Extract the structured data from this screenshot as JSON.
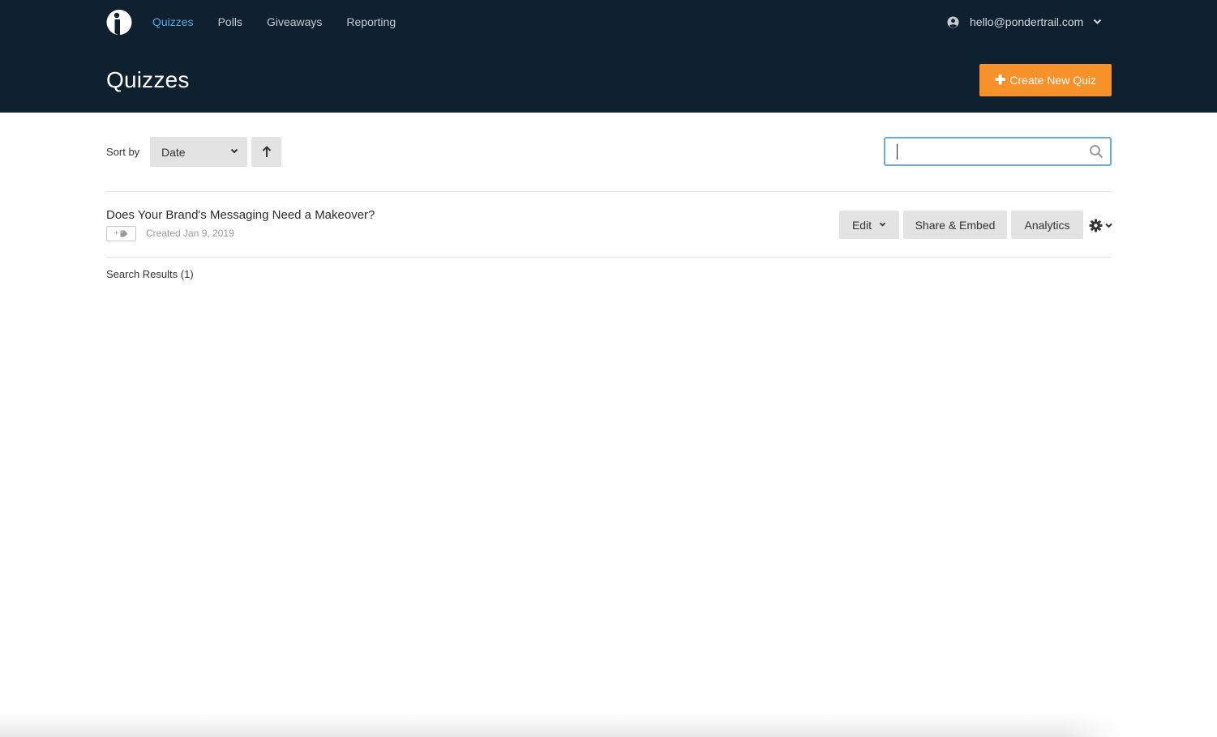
{
  "nav": {
    "items": [
      {
        "label": "Quizzes",
        "active": true
      },
      {
        "label": "Polls",
        "active": false
      },
      {
        "label": "Giveaways",
        "active": false
      },
      {
        "label": "Reporting",
        "active": false
      }
    ]
  },
  "account": {
    "email": "hello@pondertrail.com",
    "icon": "user-circle-icon"
  },
  "page": {
    "title": "Quizzes",
    "create_label": "Create New Quiz"
  },
  "toolbar": {
    "sort_label": "Sort by",
    "sort_value": "Date",
    "sort_direction_icon": "arrow-up-icon",
    "search_value": "",
    "search_icon": "search-icon"
  },
  "quizzes": [
    {
      "title": "Does Your Brand's Messaging Need a Makeover?",
      "tag_add_label": "+",
      "created": "Created Jan 9, 2019",
      "actions": {
        "edit": "Edit",
        "share": "Share & Embed",
        "analytics": "Analytics"
      }
    }
  ],
  "results": {
    "label": "Search Results (1)"
  },
  "colors": {
    "header_bg": "#0f212e",
    "accent_orange": "#f7922a",
    "active_nav": "#5aa9e6",
    "search_focus": "#6aaad9"
  }
}
